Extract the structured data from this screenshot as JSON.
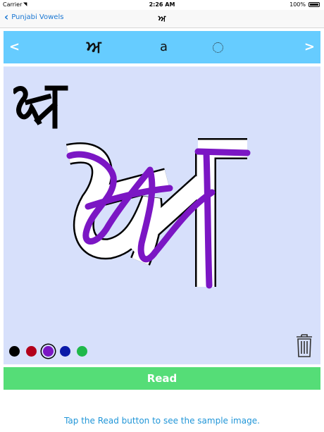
{
  "status_bar": {
    "carrier": "Carrier",
    "time": "2:26 AM",
    "battery": "100%"
  },
  "nav": {
    "back_label": "Punjabi Vowels",
    "title": "ਅ"
  },
  "letter_bar": {
    "left_arrow": "<",
    "gurmukhi": "ਅ",
    "latin": "a",
    "right_arrow": ">"
  },
  "canvas": {
    "sample_letter": "ਅ",
    "trace_letter": "ਅ",
    "stroke_color": "#7b16c4",
    "selected_color": "purple",
    "colors": [
      {
        "name": "black",
        "hex": "#000000"
      },
      {
        "name": "red",
        "hex": "#b3001b"
      },
      {
        "name": "purple",
        "hex": "#7b16c4"
      },
      {
        "name": "blue",
        "hex": "#0a1aa8"
      },
      {
        "name": "green",
        "hex": "#1fb84a"
      }
    ]
  },
  "read_button": {
    "label": "Read"
  },
  "hint": "Tap the Read button to see the sample image."
}
